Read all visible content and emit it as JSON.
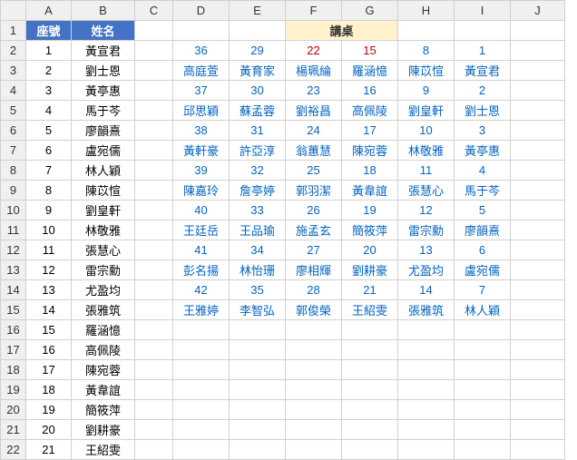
{
  "columns": [
    "A",
    "B",
    "C",
    "D",
    "E",
    "F",
    "G",
    "H",
    "I",
    "J"
  ],
  "rowCount": 22,
  "header": {
    "seatNo": "座號",
    "name": "姓名"
  },
  "desk": "講桌",
  "roster": [
    {
      "no": "1",
      "name": "黃宣君"
    },
    {
      "no": "2",
      "name": "劉士恩"
    },
    {
      "no": "3",
      "name": "黃亭惠"
    },
    {
      "no": "4",
      "name": "馬于芩"
    },
    {
      "no": "5",
      "name": "廖韻熹"
    },
    {
      "no": "6",
      "name": "盧宛儒"
    },
    {
      "no": "7",
      "name": "林人穎"
    },
    {
      "no": "8",
      "name": "陳苡愃"
    },
    {
      "no": "9",
      "name": "劉皇軒"
    },
    {
      "no": "10",
      "name": "林敬雅"
    },
    {
      "no": "11",
      "name": "張慧心"
    },
    {
      "no": "12",
      "name": "雷宗勳"
    },
    {
      "no": "13",
      "name": "尤盈均"
    },
    {
      "no": "14",
      "name": "張雅筑"
    },
    {
      "no": "15",
      "name": "羅涵憶"
    },
    {
      "no": "16",
      "name": "高佩陵"
    },
    {
      "no": "17",
      "name": "陳宛蓉"
    },
    {
      "no": "18",
      "name": "黃韋誼"
    },
    {
      "no": "19",
      "name": "簡筱萍"
    },
    {
      "no": "20",
      "name": "劉耕豪"
    },
    {
      "no": "21",
      "name": "王紹雯"
    }
  ],
  "seating": [
    {
      "nums": [
        "36",
        "29",
        "22",
        "15",
        "8",
        "1"
      ],
      "names": [
        "高庭萱",
        "黃育家",
        "楊珮綸",
        "羅涵憶",
        "陳苡愃",
        "黃宣君"
      ],
      "red": [
        2,
        3
      ]
    },
    {
      "nums": [
        "37",
        "30",
        "23",
        "16",
        "9",
        "2"
      ],
      "names": [
        "邱思穎",
        "蘇孟蓉",
        "劉裕昌",
        "高佩陵",
        "劉皇軒",
        "劉士恩"
      ],
      "red": []
    },
    {
      "nums": [
        "38",
        "31",
        "24",
        "17",
        "10",
        "3"
      ],
      "names": [
        "黃軒豪",
        "許亞淳",
        "翁蕙慧",
        "陳宛蓉",
        "林敬雅",
        "黃亭惠"
      ],
      "red": []
    },
    {
      "nums": [
        "39",
        "32",
        "25",
        "18",
        "11",
        "4"
      ],
      "names": [
        "陳嘉玲",
        "詹亭婷",
        "郭羽潔",
        "黃韋誼",
        "張慧心",
        "馬于芩"
      ],
      "red": []
    },
    {
      "nums": [
        "40",
        "33",
        "26",
        "19",
        "12",
        "5"
      ],
      "names": [
        "王廷岳",
        "王品瑜",
        "施孟玄",
        "簡筱萍",
        "雷宗勳",
        "廖韻熹"
      ],
      "red": []
    },
    {
      "nums": [
        "41",
        "34",
        "27",
        "20",
        "13",
        "6"
      ],
      "names": [
        "彭名揚",
        "林怡珊",
        "廖相輝",
        "劉耕豪",
        "尤盈均",
        "盧宛儒"
      ],
      "red": []
    },
    {
      "nums": [
        "42",
        "35",
        "28",
        "21",
        "14",
        "7"
      ],
      "names": [
        "王雅婷",
        "李智弘",
        "郭俊榮",
        "王紹雯",
        "張雅筑",
        "林人穎"
      ],
      "red": []
    }
  ]
}
